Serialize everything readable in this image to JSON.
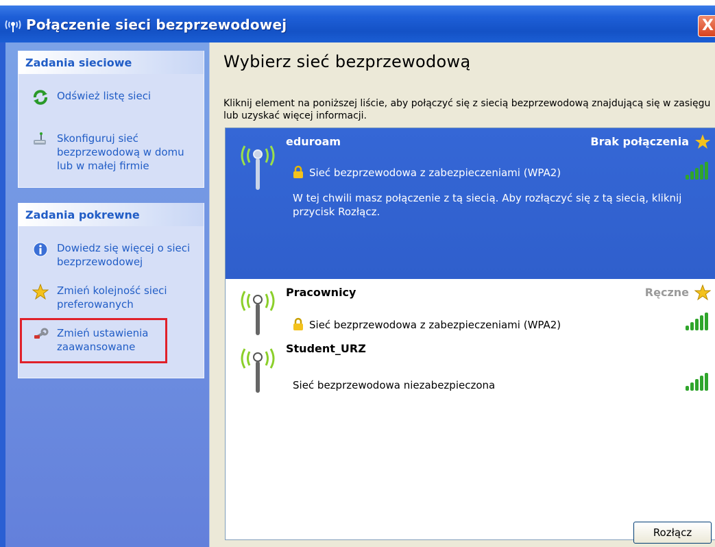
{
  "window": {
    "title": "Połączenie sieci bezprzewodowej",
    "close_label": "X"
  },
  "sidebar": {
    "network_tasks": {
      "heading": "Zadania sieciowe",
      "items": [
        {
          "label": "Odśwież listę sieci",
          "icon": "refresh-icon"
        },
        {
          "label": "Skonfiguruj sieć bezprzewodową w domu lub w małej firmie",
          "icon": "network-setup-icon"
        }
      ]
    },
    "related_tasks": {
      "heading": "Zadania pokrewne",
      "items": [
        {
          "label": "Dowiedz się więcej o sieci bezprzewodowej",
          "icon": "info-icon"
        },
        {
          "label": "Zmień kolejność sieci preferowanych",
          "icon": "star-icon"
        },
        {
          "label": "Zmień ustawienia zaawansowane",
          "icon": "settings-wrench-icon"
        }
      ]
    }
  },
  "main": {
    "title": "Wybierz sieć bezprzewodową",
    "description": "Kliknij element na poniższej liście, aby połączyć się z siecią bezprzewodową znajdującą się w zasięgu lub uzyskać więcej informacji.",
    "networks": [
      {
        "name": "eduroam",
        "status": "Brak połączenia",
        "security": "Sieć bezprzewodowa z zabezpieczeniami (WPA2)",
        "message": "W tej chwili masz połączenie z tą siecią. Aby rozłączyć się z tą siecią, kliknij przycisk Rozłącz.",
        "selected": true
      },
      {
        "name": "Pracownicy",
        "status": "Ręczne",
        "security": "Sieć bezprzewodowa z zabezpieczeniami (WPA2)",
        "selected": false
      },
      {
        "name": "Student_URZ",
        "status": "",
        "security": "Sieć bezprzewodowa niezabezpieczona",
        "selected": false
      }
    ],
    "disconnect_label": "Rozłącz"
  },
  "colors": {
    "titlebar": "#1452c6",
    "selection": "#3567d6",
    "task_link": "#215dc6",
    "highlight": "#e0202a",
    "signal": "#2fa52b"
  }
}
